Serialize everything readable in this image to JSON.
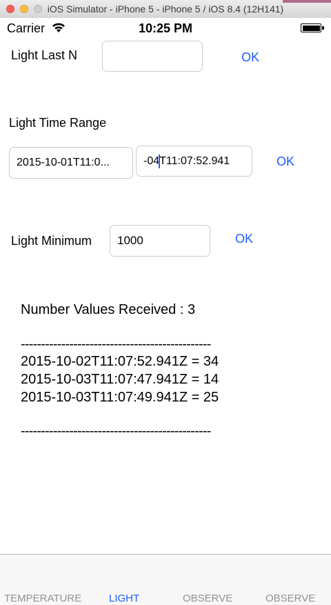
{
  "window": {
    "title": "iOS Simulator - iPhone 5 - iPhone 5 / iOS 8.4 (12H141)"
  },
  "status_bar": {
    "carrier": "Carrier",
    "time": "10:25 PM"
  },
  "last_n": {
    "label": "Light Last N",
    "value": "",
    "ok": "OK"
  },
  "time_range": {
    "label": "Light Time Range",
    "start_value": "2015-10-01T11:0...",
    "end_value_before_caret": "-04",
    "end_value_after_caret": "T11:07:52.941",
    "ok": "OK"
  },
  "minimum": {
    "label": "Light Minimum",
    "value": "1000",
    "ok": "OK"
  },
  "results": {
    "count_text": "Number Values Received : 3",
    "divider": "-----------------------------------------------",
    "lines": [
      "2015-10-02T11:07:52.941Z = 34",
      "2015-10-03T11:07:47.941Z = 14",
      "2015-10-03T11:07:49.941Z = 25"
    ]
  },
  "tabs": [
    {
      "label": "TEMPERATURE",
      "active": false
    },
    {
      "label": "LIGHT",
      "active": true
    },
    {
      "label": "OBSERVE",
      "active": false
    },
    {
      "label": "OBSERVE",
      "active": false
    }
  ],
  "colors": {
    "accent": "#1a5cff",
    "tab_inactive": "#929292",
    "caret": "#3d5cf0"
  }
}
